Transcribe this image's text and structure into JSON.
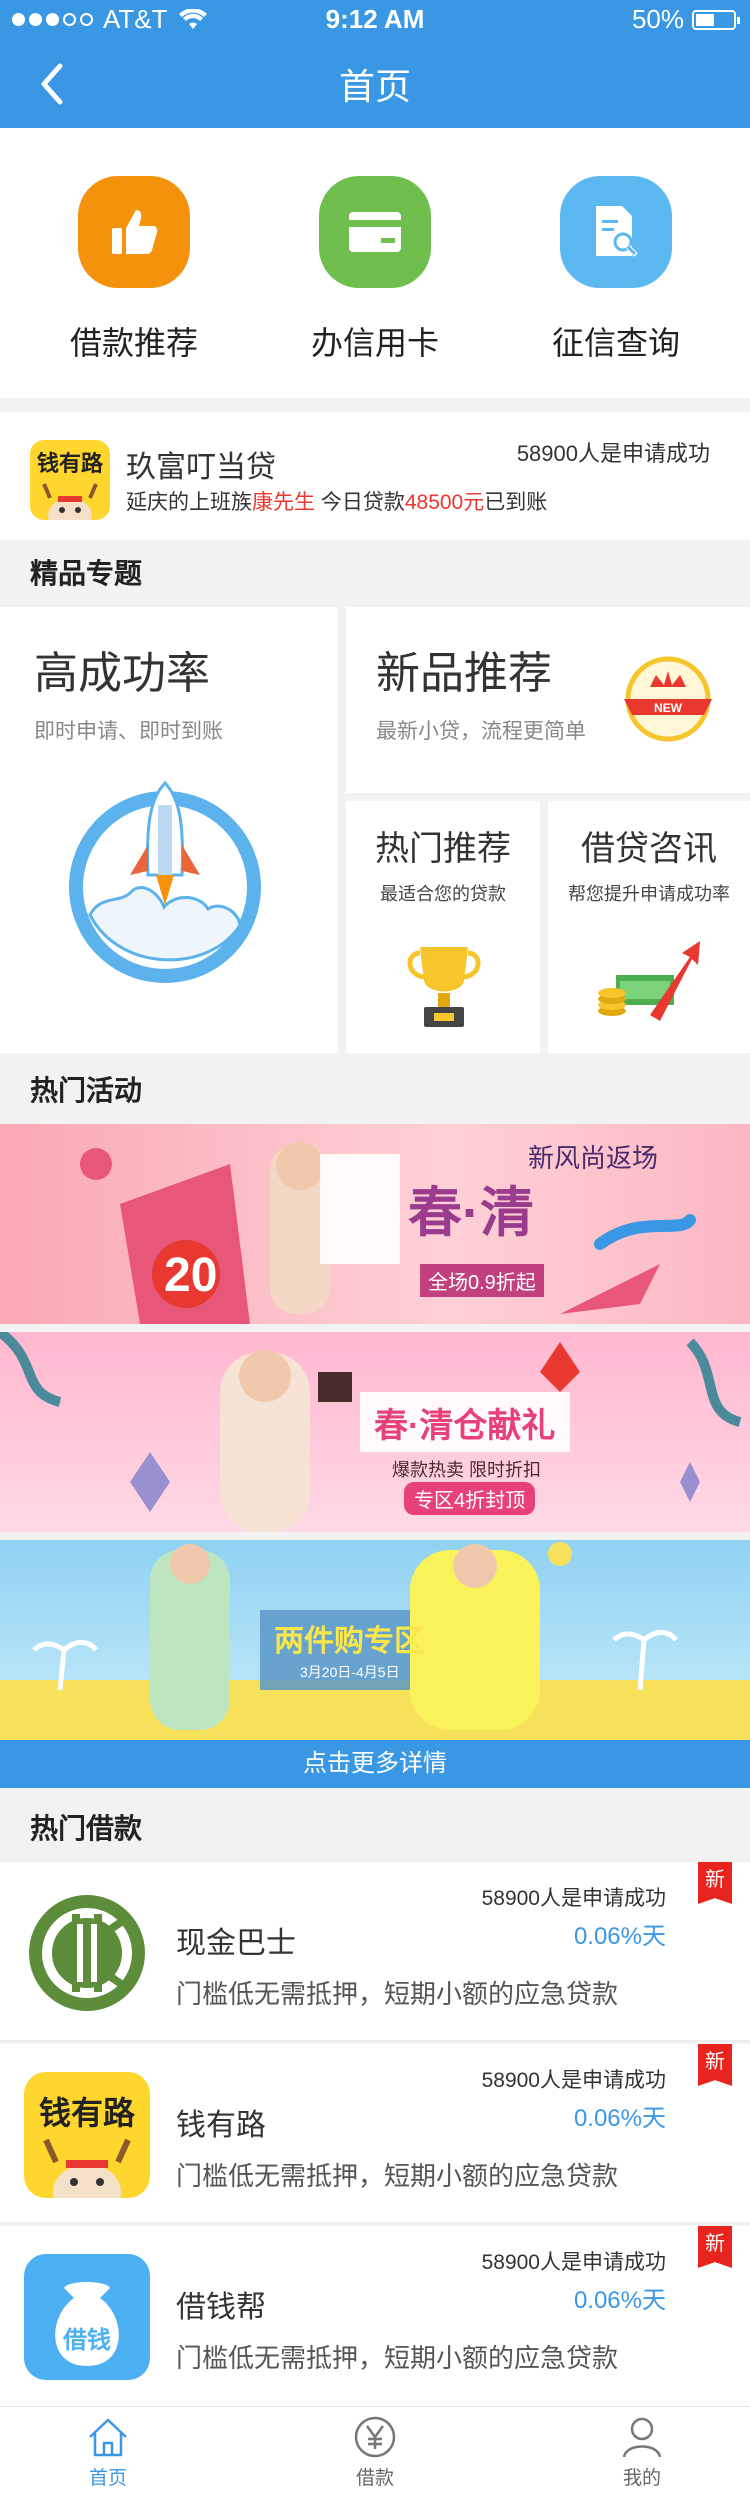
{
  "status": {
    "carrier": "AT&T",
    "time": "9:12 AM",
    "battery": "50%",
    "battery_level": 0.5
  },
  "nav": {
    "title": "首页",
    "back_icon": "chevron-left-icon"
  },
  "quick": [
    {
      "label": "借款推荐",
      "icon": "thumbs-up-icon",
      "color": "#f5920c"
    },
    {
      "label": "办信用卡",
      "icon": "credit-card-icon",
      "color": "#6fbe4e"
    },
    {
      "label": "征信查询",
      "icon": "document-search-icon",
      "color": "#5bb8f0"
    }
  ],
  "notice": {
    "logo_text": "钱有路",
    "name": "玖富叮当贷",
    "count": "58900人是申请成功",
    "line_prefix": "延庆的上班族",
    "line_person": "康先生",
    "line_mid": "  今日贷款",
    "line_amount": "48500元",
    "line_suffix": "已到账"
  },
  "sections": {
    "featured": "精品专题",
    "activities": "热门活动",
    "loans": "热门借款"
  },
  "featured": {
    "main": {
      "title": "高成功率",
      "subtitle": "即时申请、即时到账"
    },
    "new": {
      "title": "新品推荐",
      "subtitle": "最新小贷，流程更简单",
      "badge": "NEW"
    },
    "hot": {
      "title": "热门推荐",
      "subtitle": "最适合您的贷款"
    },
    "news": {
      "title": "借贷咨讯",
      "subtitle": "帮您提升申请成功率"
    }
  },
  "banners": [
    {
      "headline": "春·清",
      "tag": "新风尚返场",
      "price": "20",
      "note": "全场0.9折起",
      "colors": [
        "#f9a8b4",
        "#ffd0d6"
      ]
    },
    {
      "headline": "春·清仓献礼",
      "tag": "专区4折封顶",
      "note": "爆款热卖 限时折扣",
      "colors": [
        "#ffb7d0",
        "#ffd9e6"
      ]
    },
    {
      "headline": "两件购专区",
      "note": "3月20日-4月5日",
      "colors": [
        "#8fd2f2",
        "#f7e15a"
      ]
    }
  ],
  "more": "点击更多详情",
  "loans": [
    {
      "name": "现金巴士",
      "count": "58900人是申请成功",
      "rate": "0.06%天",
      "desc": "门槛低无需抵押，短期小额的应急贷款",
      "badge": "新",
      "logo": "cash-bus-logo"
    },
    {
      "name": "钱有路",
      "count": "58900人是申请成功",
      "rate": "0.06%天",
      "desc": "门槛低无需抵押，短期小额的应急贷款",
      "badge": "新",
      "logo": "qianyoulu-logo",
      "logo_text": "钱有路"
    },
    {
      "name": "借钱帮",
      "count": "58900人是申请成功",
      "rate": "0.06%天",
      "desc": "门槛低无需抵押，短期小额的应急贷款",
      "badge": "新",
      "logo": "money-bag-logo",
      "logo_text": "借钱"
    }
  ],
  "tabs": [
    {
      "label": "首页",
      "icon": "home-icon",
      "active": true
    },
    {
      "label": "借款",
      "icon": "yen-icon",
      "active": false
    },
    {
      "label": "我的",
      "icon": "user-icon",
      "active": false
    }
  ],
  "colors": {
    "primary": "#3a97e4",
    "accent_red": "#e8382f",
    "bg": "#f2f2f2"
  }
}
